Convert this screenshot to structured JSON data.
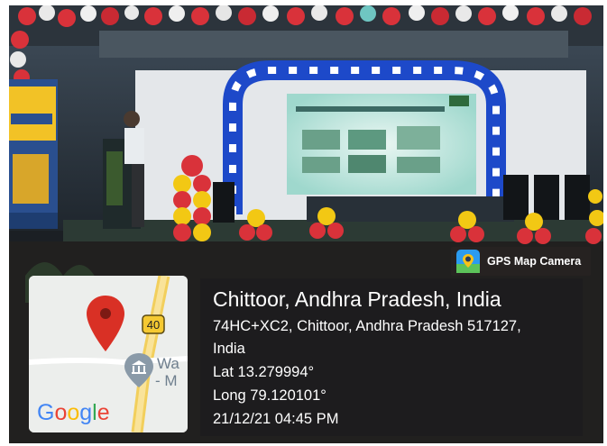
{
  "badge": {
    "label": "GPS Map Camera",
    "icon": "gps-map-camera-icon"
  },
  "map": {
    "road_number": "40",
    "place_label_line1": "Wa",
    "place_label_line2": "- M",
    "logo": "Google",
    "pin_icon": "map-pin-icon",
    "poi_icon": "museum-icon"
  },
  "location": {
    "title": "Chittoor, Andhra Pradesh, India",
    "address_line1": "74HC+XC2, Chittoor, Andhra Pradesh 517127,",
    "address_line2": "India",
    "latitude": "Lat 13.279994°",
    "longitude": "Long 79.120101°",
    "datetime": "21/12/21 04:45 PM"
  },
  "colors": {
    "pin": "#d93025",
    "road": "#f5d66b",
    "google_blue": "#4285f4",
    "google_red": "#ea4335",
    "google_yellow": "#fbbc05",
    "google_green": "#34a853"
  }
}
